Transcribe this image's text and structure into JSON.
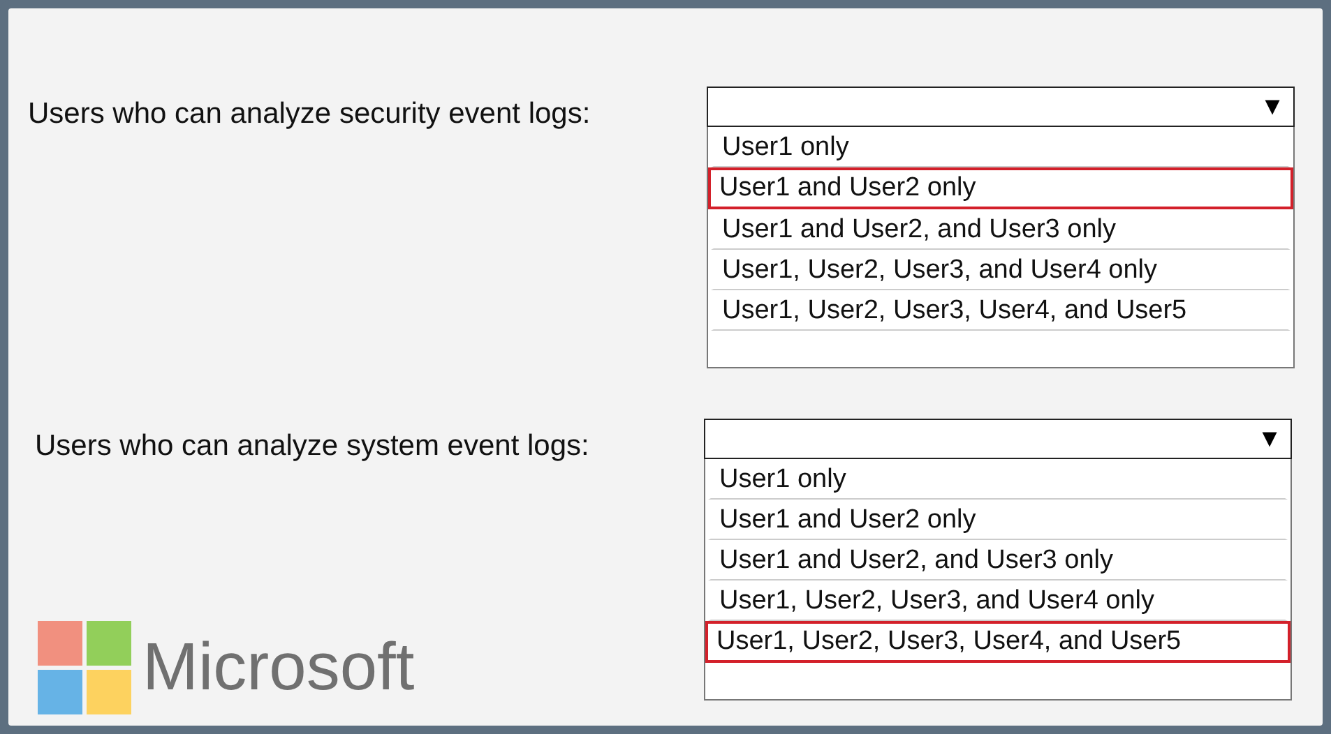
{
  "questions": [
    {
      "label": "Users who can analyze security event logs:",
      "dropdown_arrow": "▼",
      "options": [
        {
          "label": "User1 only",
          "selected": false
        },
        {
          "label": "User1 and User2 only",
          "selected": true
        },
        {
          "label": "User1 and User2, and User3 only",
          "selected": false
        },
        {
          "label": "User1, User2, User3, and User4 only",
          "selected": false
        },
        {
          "label": "User1, User2, User3, User4, and User5",
          "selected": false
        }
      ]
    },
    {
      "label": "Users who can analyze system event logs:",
      "dropdown_arrow": "▼",
      "options": [
        {
          "label": "User1 only",
          "selected": false
        },
        {
          "label": "User1 and User2 only",
          "selected": false
        },
        {
          "label": "User1 and User2, and User3 only",
          "selected": false
        },
        {
          "label": "User1, User2, User3, and User4 only",
          "selected": false
        },
        {
          "label": "User1, User2, User3, User4, and User5",
          "selected": true
        }
      ]
    }
  ],
  "logo": {
    "text": "Microsoft"
  }
}
